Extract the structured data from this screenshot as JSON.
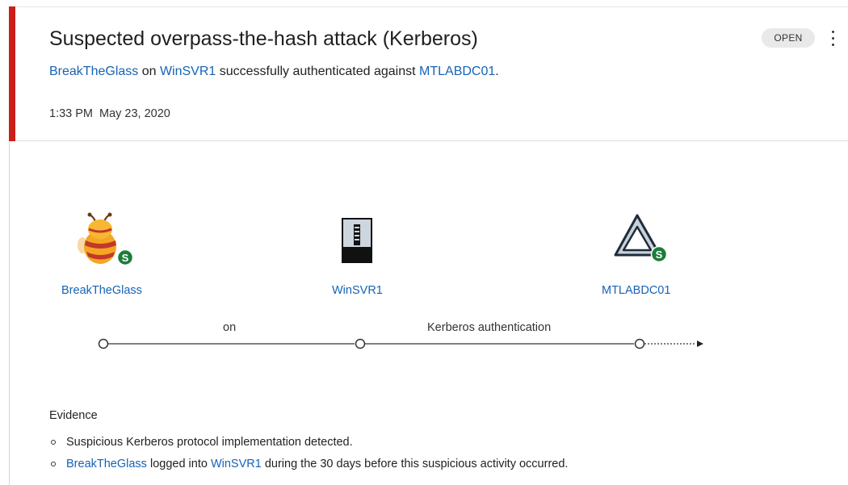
{
  "alert": {
    "title": "Suspected overpass-the-hash attack (Kerberos)",
    "status": "OPEN",
    "severity_color": "#cc1f1a",
    "subtitle": {
      "account": "BreakTheGlass",
      "word_on": " on ",
      "computer": "WinSVR1",
      "text_middle": " successfully authenticated against ",
      "domain_controller": "MTLABDC01",
      "text_end": "."
    },
    "time": "1:33 PM",
    "date": "May 23, 2020"
  },
  "entities": [
    {
      "name": "BreakTheGlass",
      "icon": "user-sensitive-icon"
    },
    {
      "name": "WinSVR1",
      "icon": "server-icon"
    },
    {
      "name": "MTLABDC01",
      "icon": "domain-controller-sensitive-icon"
    }
  ],
  "timeline": {
    "label_1": "on",
    "label_2": "Kerberos authentication"
  },
  "evidence": {
    "title": "Evidence",
    "items": [
      {
        "text": "Suspicious Kerberos protocol implementation detected."
      },
      {
        "account": "BreakTheGlass",
        "text_middle": " logged into ",
        "computer": "WinSVR1",
        "text_end": " during the 30 days before this suspicious activity occurred."
      }
    ]
  },
  "colors": {
    "link": "#1763b5",
    "badge_bg": "#e9e9e9",
    "sensitive_badge": "#1c7c3a"
  }
}
